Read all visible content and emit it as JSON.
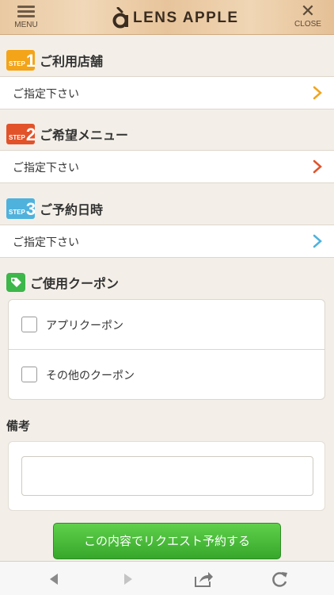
{
  "header": {
    "menu_label": "MENU",
    "logo_text": "LENS APPLE",
    "close_label": "CLOSE"
  },
  "step1": {
    "badge_word": "STEP",
    "badge_num": "1",
    "title": "ご利用店舗",
    "placeholder": "ご指定下さい",
    "color": "#f3a419"
  },
  "step2": {
    "badge_word": "STEP",
    "badge_num": "2",
    "title": "ご希望メニュー",
    "placeholder": "ご指定下さい",
    "color": "#e2532a"
  },
  "step3": {
    "badge_word": "STEP",
    "badge_num": "3",
    "title": "ご予約日時",
    "placeholder": "ご指定下さい",
    "color": "#4fb2dd"
  },
  "coupon": {
    "title": "ご使用クーポン",
    "icon": "tag-icon",
    "options": [
      {
        "label": "アプリクーポン",
        "checked": false
      },
      {
        "label": "その他のクーポン",
        "checked": false
      }
    ]
  },
  "remarks": {
    "label": "備考",
    "value": ""
  },
  "submit_label": "この内容でリクエスト予約する",
  "toolbar": {
    "icons": [
      "back-icon",
      "forward-icon",
      "share-icon",
      "reload-icon"
    ]
  },
  "colors": {
    "accent_green": "#3db64a",
    "background": "#f3efe8"
  }
}
